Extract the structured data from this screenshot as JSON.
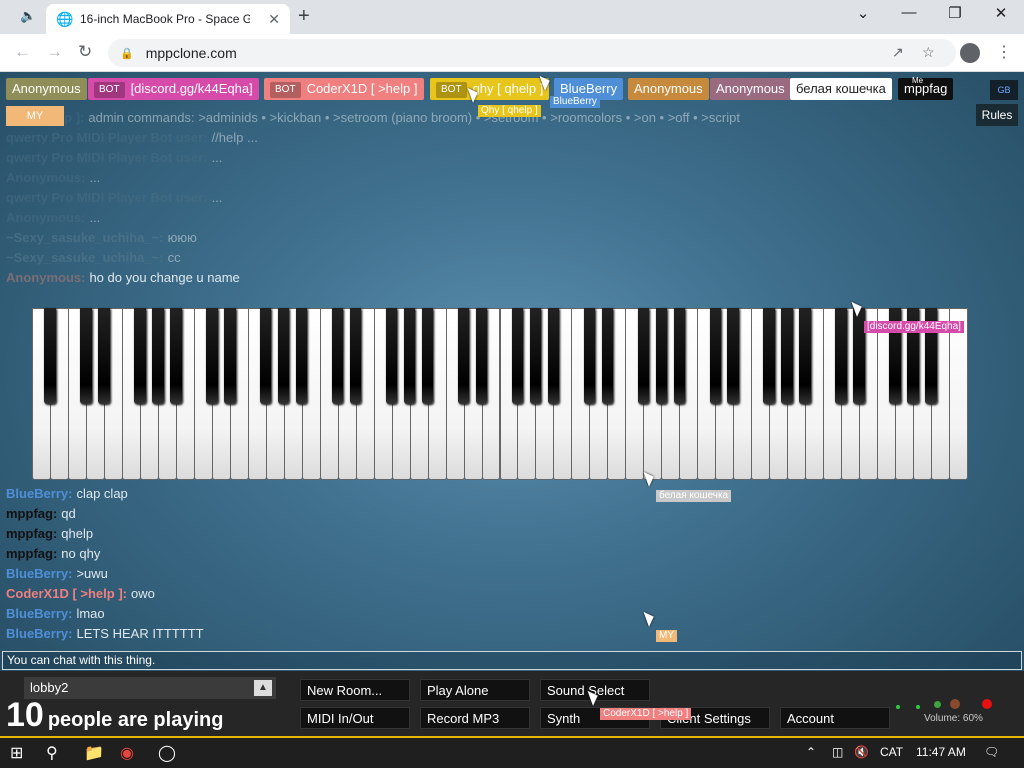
{
  "browser": {
    "tab_title": "16-inch MacBook Pro - Space Gr",
    "url": "mppclone.com"
  },
  "users": [
    {
      "name": "Anonymous",
      "bot": "",
      "color": "#8f8e58"
    },
    {
      "name": "[discord.gg/k44Eqha]",
      "bot": "BOT",
      "color": "#d64aa9"
    },
    {
      "name": "CoderX1D [ >help ]",
      "bot": "BOT",
      "color": "#f07f7f"
    },
    {
      "name": "ghy [ qhelp ]",
      "bot": "BOT",
      "color": "#e8c51a"
    },
    {
      "name": "BlueBerry",
      "bot": "",
      "color": "#4f8fd8"
    },
    {
      "name": "Anonymous",
      "bot": "",
      "color": "#c78a3c"
    },
    {
      "name": "Anonymous",
      "bot": "",
      "color": "#9a6b7f"
    },
    {
      "name": "белая кошечка",
      "bot": "",
      "color": "#ffffff"
    },
    {
      "name": "mppfag",
      "bot": "",
      "color": "#101010"
    }
  ],
  "me_tag": "Me",
  "my_button": "MY",
  "rules_button": "Rules",
  "gb_button": "GB",
  "cursors": {
    "ghy": "Qhy [ qhelp ]",
    "blueberry": "BlueBerry",
    "discord": "[discord.gg/k44Eqha]",
    "kitten": "белая кошечка",
    "coder": "CoderX1D [ >help ]",
    "my": "MY"
  },
  "chat": [
    {
      "who": "...D [ >help ]:",
      "text": "admin commands: >adminids • >kickban • >setroom (piano broom) • >setroom • >roomcolors • >on • >off • >script",
      "color": "#3c6f8d",
      "faded": true
    },
    {
      "who": "qwerty Pro MIDI Player Bot user:",
      "text": "//help ...",
      "color": "#4a6f85",
      "faded": true
    },
    {
      "who": "qwerty Pro MIDI Player Bot user:",
      "text": "...",
      "color": "#4a6f85",
      "faded": true
    },
    {
      "who": "Anonymous:",
      "text": "...",
      "color": "#4a6f85",
      "faded": true
    },
    {
      "who": "qwerty Pro MIDI Player Bot user:",
      "text": "...",
      "color": "#4a6f85",
      "faded": true
    },
    {
      "who": "Anonymous:",
      "text": "...",
      "color": "#4a6f85",
      "faded": true
    },
    {
      "who": "~Sexy_sasuke_uchiha_~:",
      "text": "ююю",
      "color": "#5b7f91",
      "faded": true
    },
    {
      "who": "~Sexy_sasuke_uchiha_~:",
      "text": "сс",
      "color": "#5b7f91",
      "faded": true
    },
    {
      "who": "Anonymous:",
      "text": "ho do you change u name",
      "color": "#7a6e75",
      "faded": false
    }
  ],
  "chat_lower": [
    {
      "who": "BlueBerry:",
      "text": "clap clap",
      "color": "#4f8fd8"
    },
    {
      "who": "mppfag:",
      "text": "qd",
      "color": "#111111"
    },
    {
      "who": "mppfag:",
      "text": "qhelp",
      "color": "#111111"
    },
    {
      "who": "mppfag:",
      "text": "no qhy",
      "color": "#111111"
    },
    {
      "who": "BlueBerry:",
      "text": ">uwu",
      "color": "#4f8fd8"
    },
    {
      "who": "CoderX1D [ >help ]:",
      "text": "owo",
      "color": "#f07f7f"
    },
    {
      "who": "BlueBerry:",
      "text": "lmao",
      "color": "#4f8fd8"
    },
    {
      "who": "BlueBerry:",
      "text": "LETS HEAR ITTTTTT",
      "color": "#4f8fd8"
    }
  ],
  "chat_placeholder": "You can chat with this thing.",
  "room": "lobby2",
  "count_number": "10",
  "count_text": "people are playing",
  "buttons": {
    "new_room": "New Room...",
    "play_alone": "Play Alone",
    "sound_select": "Sound Select",
    "midi": "MIDI In/Out",
    "record": "Record MP3",
    "synth": "Synth",
    "client_settings": "Client Settings",
    "account": "Account"
  },
  "volume": "Volume: 60%",
  "taskbar": {
    "lang": "CAT",
    "time": "11:47 AM"
  }
}
